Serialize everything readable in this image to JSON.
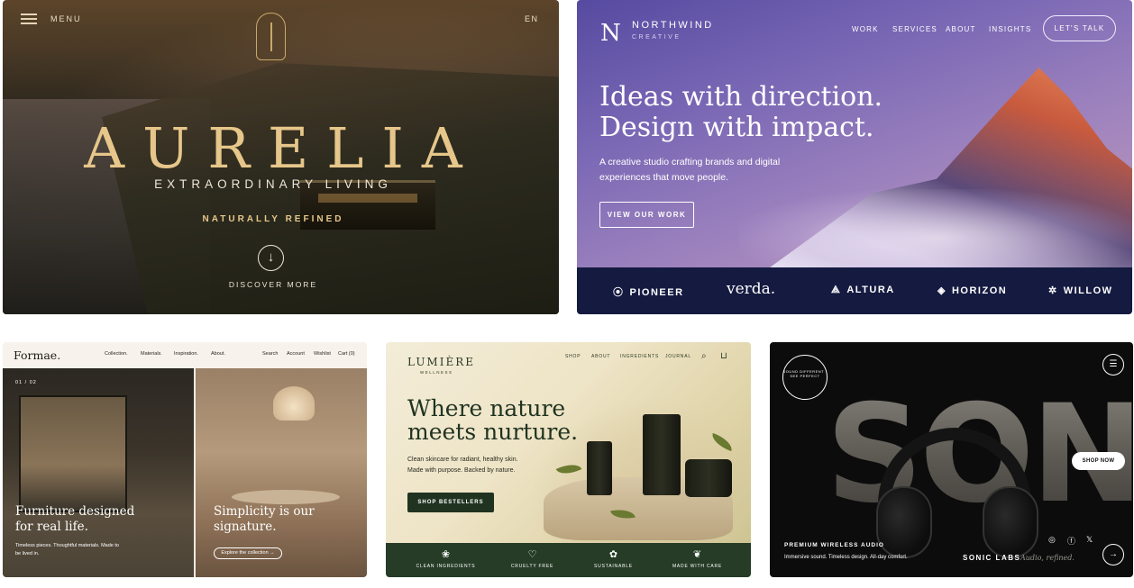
{
  "aurelia": {
    "menu_label": "MENU",
    "lang": "EN",
    "brand": "AURELIA",
    "tagline": "EXTRAORDINARY LIVING",
    "subtitle": "NATURALLY REFINED",
    "discover": "DISCOVER MORE",
    "accent_color": "#e6c68a"
  },
  "northwind": {
    "logo_mark": "N",
    "logo_name": "NORTHWIND",
    "logo_sub": "CREATIVE",
    "nav": [
      "WORK",
      "SERVICES",
      "ABOUT",
      "INSIGHTS"
    ],
    "cta": "LET'S TALK",
    "headline_1": "Ideas with direction.",
    "headline_2": "Design with impact.",
    "description": "A creative studio crafting brands and digital experiences that move people.",
    "button": "VIEW OUR WORK",
    "clients": [
      {
        "name": "PIONEER",
        "icon": "⦿"
      },
      {
        "name": "verda.",
        "icon": ""
      },
      {
        "name": "ALTURA",
        "icon": "⟁"
      },
      {
        "name": "HORIZON",
        "icon": "◈"
      },
      {
        "name": "WILLOW",
        "icon": "✲"
      }
    ],
    "footer_color": "#141a40"
  },
  "formae": {
    "logo": "Formae.",
    "nav_left": [
      "Collection.",
      "Materials.",
      "Inspiration.",
      "About."
    ],
    "nav_right": [
      "Search",
      "Account",
      "Wishlist",
      "Cart (0)"
    ],
    "counter": "01 / 02",
    "heading_left": "Furniture designed for real life.",
    "paragraph_left": "Timeless pieces. Thoughtful materials. Made to be lived in.",
    "heading_right": "Simplicity is our signature.",
    "explore": "Explore the collection →"
  },
  "lumiere": {
    "logo": "LUMIÈRE",
    "logo_sub": "WELLNESS",
    "nav": [
      "SHOP",
      "ABOUT",
      "INGREDIENTS",
      "JOURNAL"
    ],
    "headline_1": "Where nature",
    "headline_2": "meets nurture.",
    "description_1": "Clean skincare for radiant, healthy skin.",
    "description_2": "Made with purpose. Backed by nature.",
    "button": "SHOP BESTELLERS",
    "features": [
      {
        "label": "CLEAN INGREDIENTS",
        "icon": "❀"
      },
      {
        "label": "CRUELTY FREE",
        "icon": "♡"
      },
      {
        "label": "SUSTAINABLE",
        "icon": "✿"
      },
      {
        "label": "MADE WITH CARE",
        "icon": "❦"
      }
    ],
    "brand_color": "#263c27"
  },
  "sonic": {
    "word": "SONIC",
    "badge": "SOUND DIFFERENT · SEE PERFECT",
    "shop": "SHOP NOW",
    "product_label": "PREMIUM WIRELESS AUDIO",
    "product_desc": "Immersive sound. Timeless design. All-day comfort.",
    "labs": "SONIC LABS",
    "refined": "Audio, refined.",
    "social": [
      "◎",
      "ⓕ",
      "𝕏"
    ]
  }
}
